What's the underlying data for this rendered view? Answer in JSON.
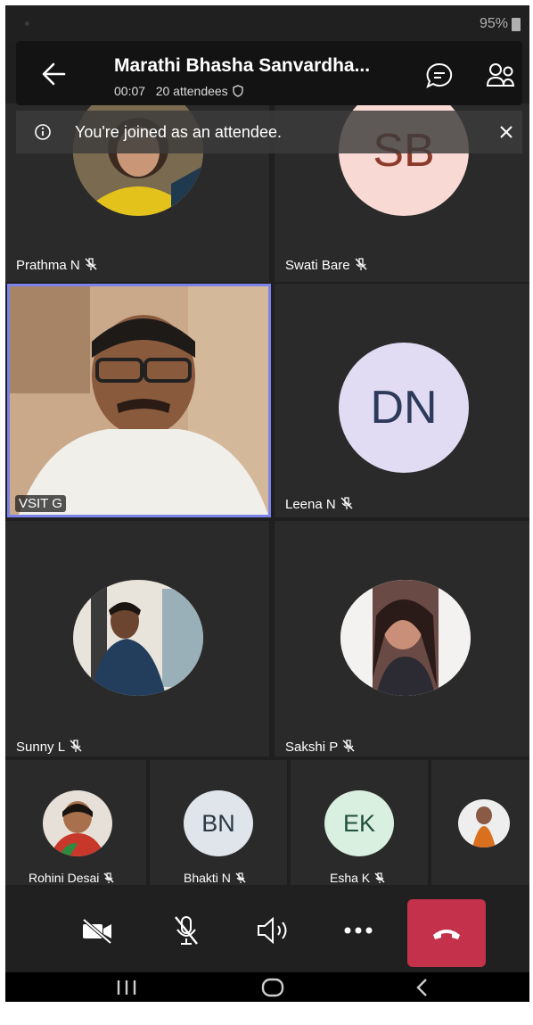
{
  "status_bar": {
    "battery": "95%"
  },
  "header": {
    "title": "Marathi Bhasha Sanvardha...",
    "duration": "00:07",
    "attendees": "20 attendees"
  },
  "banner": {
    "text": "You're joined as an attendee."
  },
  "tiles": [
    {
      "name": "Prathma N",
      "avatar": "photo"
    },
    {
      "name": "Swati Bare",
      "initials": "SB"
    },
    {
      "name": "VSIT G",
      "avatar": "video"
    },
    {
      "name": "Leena N",
      "initials": "DN"
    },
    {
      "name": "Sunny L",
      "avatar": "photo"
    },
    {
      "name": "Sakshi P",
      "avatar": "photo"
    }
  ],
  "strip": [
    {
      "name": "Rohini Desai",
      "avatar": "photo"
    },
    {
      "name": "Bhakti N",
      "initials": "BN"
    },
    {
      "name": "Esha K",
      "initials": "EK"
    },
    {
      "name": "",
      "avatar": "photo"
    }
  ],
  "controls": [
    "camera-off-icon",
    "mic-off-icon",
    "speaker-icon",
    "more-icon",
    "hang-up-icon"
  ],
  "colors": {
    "hangup": "#c4314b",
    "active_tile_border": "#7b83eb",
    "initials_sb_bg": "#f9d9d3",
    "initials_dn_bg": "#e1dcf3",
    "initials_bn_bg": "#dfe5ea",
    "initials_ek_bg": "#d9efe0"
  }
}
